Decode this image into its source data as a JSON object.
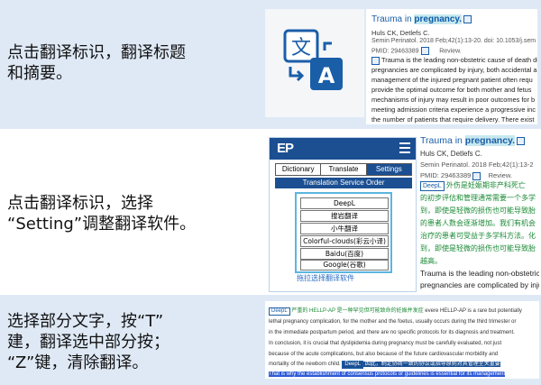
{
  "row1": {
    "instruction_lines": [
      "点击翻译标识，翻译标题",
      "和摘要。"
    ],
    "paper": {
      "title_prefix": "Trauma in ",
      "title_highlight": "pregnancy.",
      "authors": "Huls CK, Detlefs C.",
      "citation": "Semin Perinatol. 2018 Feb;42(1):13-20. doi: 10.1053/j.sem",
      "pmid": "PMID: 29463389",
      "review": "Review.",
      "abstract_lines": [
        "Trauma is the leading non-obstetric cause of death du",
        "pregnancies are complicated by injury, both accidental a",
        "management of the injured pregnant patient often requ",
        "provide the optimal outcome for both mother and fetus",
        "mechanisms of injury may result in poor outcomes for b",
        "meeting admission criteria experience a progressive inc",
        "the number of patients that require delivery. There exist"
      ]
    }
  },
  "row2": {
    "instruction_lines": [
      "点击翻译标识，选择",
      "“Setting”调整翻译软件。"
    ],
    "extension": {
      "logo": "EP",
      "tabs": [
        {
          "label": "Dictionary",
          "active": false
        },
        {
          "label": "Translate",
          "active": false
        },
        {
          "label": "Settings",
          "active": true
        }
      ],
      "section_title": "Translation Service Order",
      "services": [
        "DeepL",
        "搜岩翻译",
        "小牛翻译",
        "Colorful-clouds(彩云小译)",
        "Baidu(百度)",
        "Google(谷歌)"
      ],
      "hint": "拖拉选择翻译软件"
    },
    "paper": {
      "title_prefix": "Trauma in ",
      "title_highlight": "pregnancy.",
      "authors": "Huls CK, Detlefs C.",
      "citation": "Semin Perinatol. 2018 Feb;42(1):13-2",
      "pmid": "PMID: 29463389",
      "review": "Review.",
      "deepl_tag": "DeepL",
      "translation_lines": [
        "外伤是妊娠期非产科死亡",
        "的初步评估和管理通常需要一个多学",
        "到，即使是轻微的损伤也可能导致胎",
        "的患者人数会逐渐增加。我们有机会",
        "治疗的患者可受益于多学科方法。化",
        "到，即使是轻微的损伤也可能导致胎",
        "越高。"
      ],
      "english_lines": [
        "Trauma is the leading non-obstetric",
        "pregnancies are complicated by injur",
        "management of the injured pregnant"
      ]
    }
  },
  "row3": {
    "instruction_lines": [
      "选择部分文字，按“T”",
      "建，翻译选中部分按；",
      "“Z”键，清除翻译。"
    ],
    "paper": {
      "tag1": "DeepL",
      "line1_cn": "严重的 HELLP-AP 是一种罕见但可能致命的妊娠并发症",
      "line1_en": "evere HELLP-AP is a rare but potentially",
      "lines": [
        "lethal pregnancy complication, for the mother and the foetus, usually occurs during the third trimester or",
        "in the immediate postpartum period, and there are no specific protocols for its diagnosis and treatment.",
        "In conclusion, it is crucial that dyslipidemia during pregnancy must be carefully evaluated, not just",
        "because of the acute complications, but also because of the future cardiovascular morbidity and"
      ],
      "line6_prefix": "mortality of the newborn child.",
      "tag2": "DeepL",
      "line6_cn": "因此，制定协商一致的协议或指导原则对其管理至关重要",
      "line7_highlight": "That is why the establishment of consensus protocols or guidelines is essential for its management"
    }
  }
}
